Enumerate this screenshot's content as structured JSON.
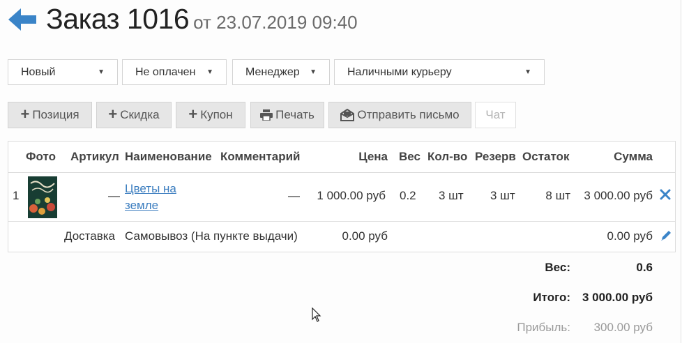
{
  "header": {
    "title": "Заказ 1016",
    "date": "от 23.07.2019 09:40"
  },
  "selects": {
    "status": "Новый",
    "payment": "Не оплачен",
    "manager": "Менеджер",
    "payment_method": "Наличными курьеру"
  },
  "toolbar": {
    "position": "Позиция",
    "discount": "Скидка",
    "coupon": "Купон",
    "print": "Печать",
    "send_email": "Отправить письмо",
    "chat": "Чат"
  },
  "table": {
    "columns": [
      "Фото",
      "Артикул",
      "Наименование",
      "Комментарий",
      "Цена",
      "Вес",
      "Кол-во",
      "Резерв",
      "Остаток",
      "Сумма"
    ],
    "rows": [
      {
        "num": "1",
        "sku": "—",
        "name": "Цветы на\nземле",
        "comment": "—",
        "price": "1 000.00 руб",
        "weight": "0.2",
        "qty": "3 шт",
        "reserve": "3 шт",
        "stock": "8 шт",
        "sum": "3 000.00 руб"
      }
    ],
    "delivery": {
      "label": "Доставка",
      "name": "Самовывоз (На пункте выдачи)",
      "price": "0.00 руб",
      "sum": "0.00 руб"
    }
  },
  "summary": {
    "weight_label": "Вес:",
    "weight_value": "0.6",
    "total_label": "Итого:",
    "total_value": "3 000.00 руб",
    "profit_label": "Прибыль:",
    "profit_value": "300.00 руб"
  },
  "colors": {
    "accent": "#3a84c8",
    "link": "#3b7dbf",
    "button_bg": "#e6e6e6"
  }
}
